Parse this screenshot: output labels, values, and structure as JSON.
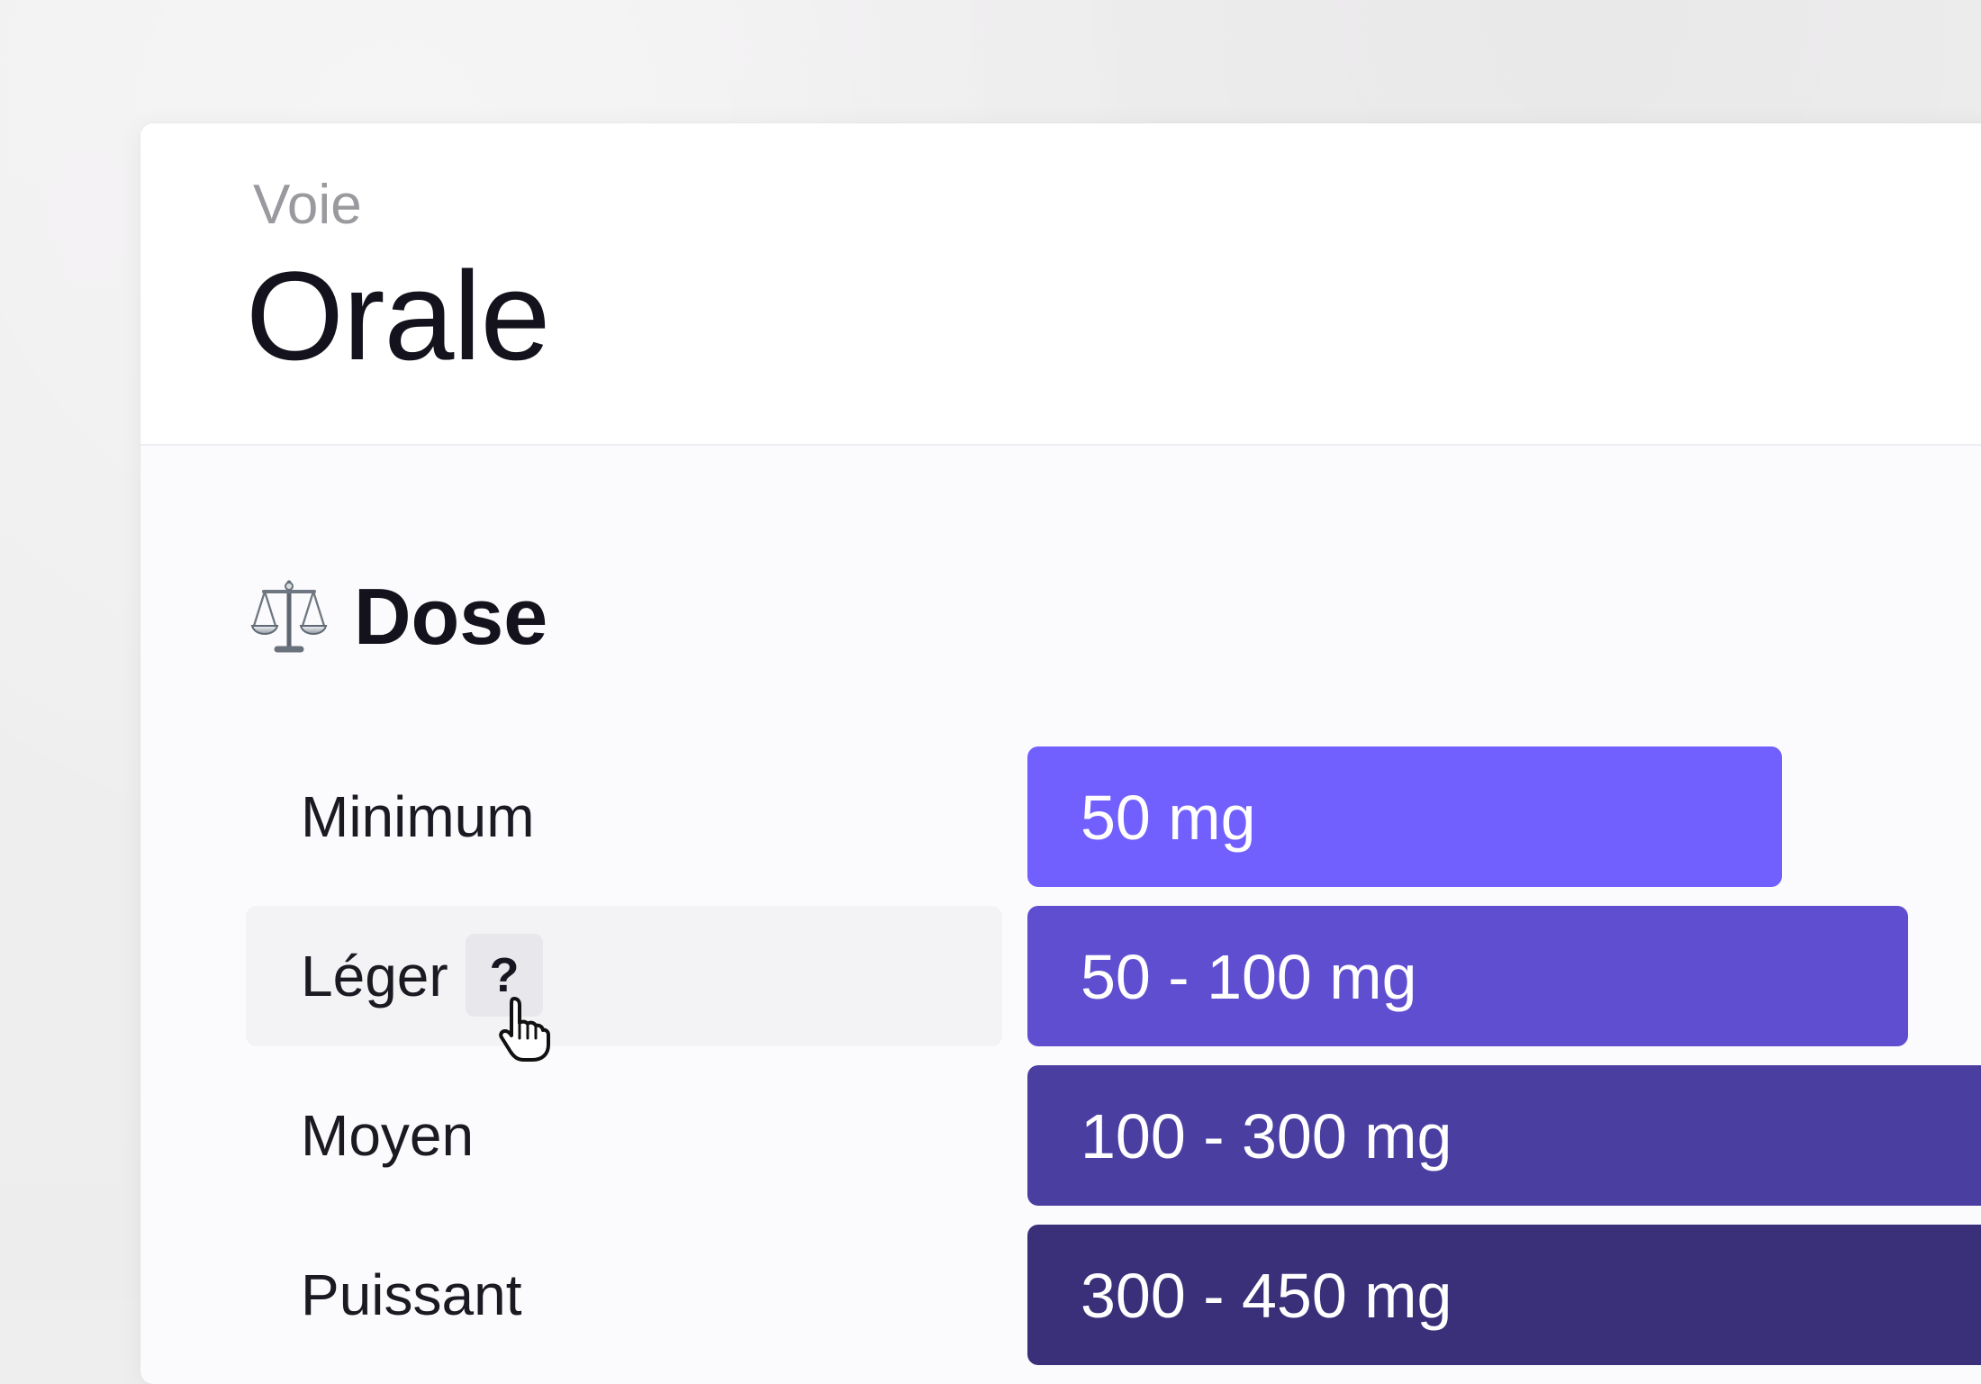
{
  "route": {
    "kicker": "Voie",
    "title": "Orale"
  },
  "dose_section": {
    "icon": "scale-icon",
    "title": "Dose",
    "rows": [
      {
        "label": "Minimum",
        "value": "50 mg",
        "color": "#715ffe"
      },
      {
        "label": "Léger",
        "value": "50 - 100 mg",
        "color": "#5f4ed0",
        "help": "?"
      },
      {
        "label": "Moyen",
        "value": "100 - 300 mg",
        "color": "#4a3ea1"
      },
      {
        "label": "Puissant",
        "value": "300 - 450 mg",
        "color": "#3a2f79"
      }
    ]
  },
  "colors": {
    "background": "#efeeef",
    "card": "#fbfafc",
    "header": "#ffffff",
    "text": "#14121c",
    "muted_text": "#9a999d"
  }
}
